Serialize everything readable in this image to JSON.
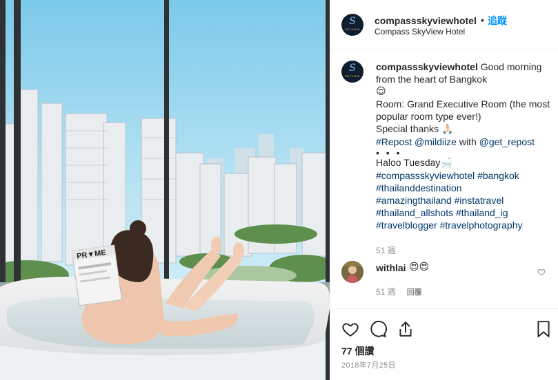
{
  "post": {
    "username": "compassskyviewhotel",
    "separator": "•",
    "follow_label": "追蹤",
    "location": "Compass SkyView Hotel",
    "avatar_logo_letter": "S",
    "avatar_logo_text": "SKYVIEW",
    "photo_magazine_text": "PR▼ME"
  },
  "caption": {
    "username": "compassskyviewhotel",
    "line1": " Good morning from the heart of Bangkok",
    "emoji1": "😌",
    "line2": "Room: Grand Executive Room (the most popular room type ever!)",
    "line3": "Special thanks ",
    "emoji2": "🙏🏻",
    "tag1": "#Repost",
    "tag2": "@mildiize",
    "with_text": " with ",
    "tag3": "@get_repost",
    "dots": "• • •",
    "line4": "Haloo Tuesday",
    "emoji3": "🛁",
    "hashtags": [
      "#compassskyviewhotel",
      "#bangkok",
      "#thailanddestination",
      "#amazingthailand",
      "#instatravel",
      "#thailand_allshots",
      "#thailand_ig",
      "#travelblogger",
      "#travelphotography"
    ]
  },
  "caption_meta": {
    "age": "51 週"
  },
  "comment": {
    "username": "withlai",
    "text": "😍😍",
    "age": "51 週",
    "reply_label": "回覆"
  },
  "actions": {
    "likes": "77 個讚",
    "date": "2018年7月25日"
  },
  "colors": {
    "link": "#00376b",
    "follow": "#0095f6",
    "muted": "#8e8e8e",
    "text": "#262626"
  }
}
